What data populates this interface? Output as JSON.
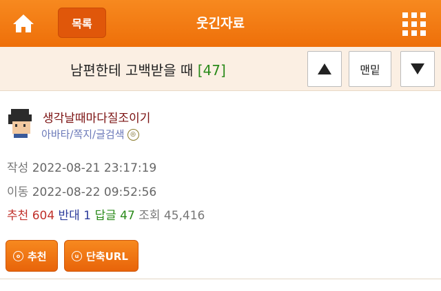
{
  "header": {
    "home_icon": "home-icon",
    "list_label": "목록",
    "board_name": "웃긴자료",
    "menu_icon": "grid-menu-icon"
  },
  "post": {
    "title": "남편한테 고백받을 때",
    "reply_count": "[47]",
    "bottom_label": "맨밑"
  },
  "author": {
    "nickname": "생각날때마다질조이기",
    "links": "아바타/쪽지/글검색"
  },
  "meta": {
    "created_label": "작성",
    "created": "2022-08-21 23:17:19",
    "moved_label": "이동",
    "moved": "2022-08-22 09:52:56"
  },
  "stats": {
    "recommend_label": "추천",
    "recommend": "604",
    "oppose_label": "반대",
    "oppose": "1",
    "reply_label": "답글",
    "reply": "47",
    "views_label": "조회",
    "views": "45,416"
  },
  "actions": {
    "recommend_button": "추천",
    "short_url_button": "단축URL"
  },
  "colors": {
    "brand_orange": "#f07a14",
    "recommend": "#c0302a",
    "oppose": "#2a3a9a",
    "reply": "#2a8a1a"
  }
}
